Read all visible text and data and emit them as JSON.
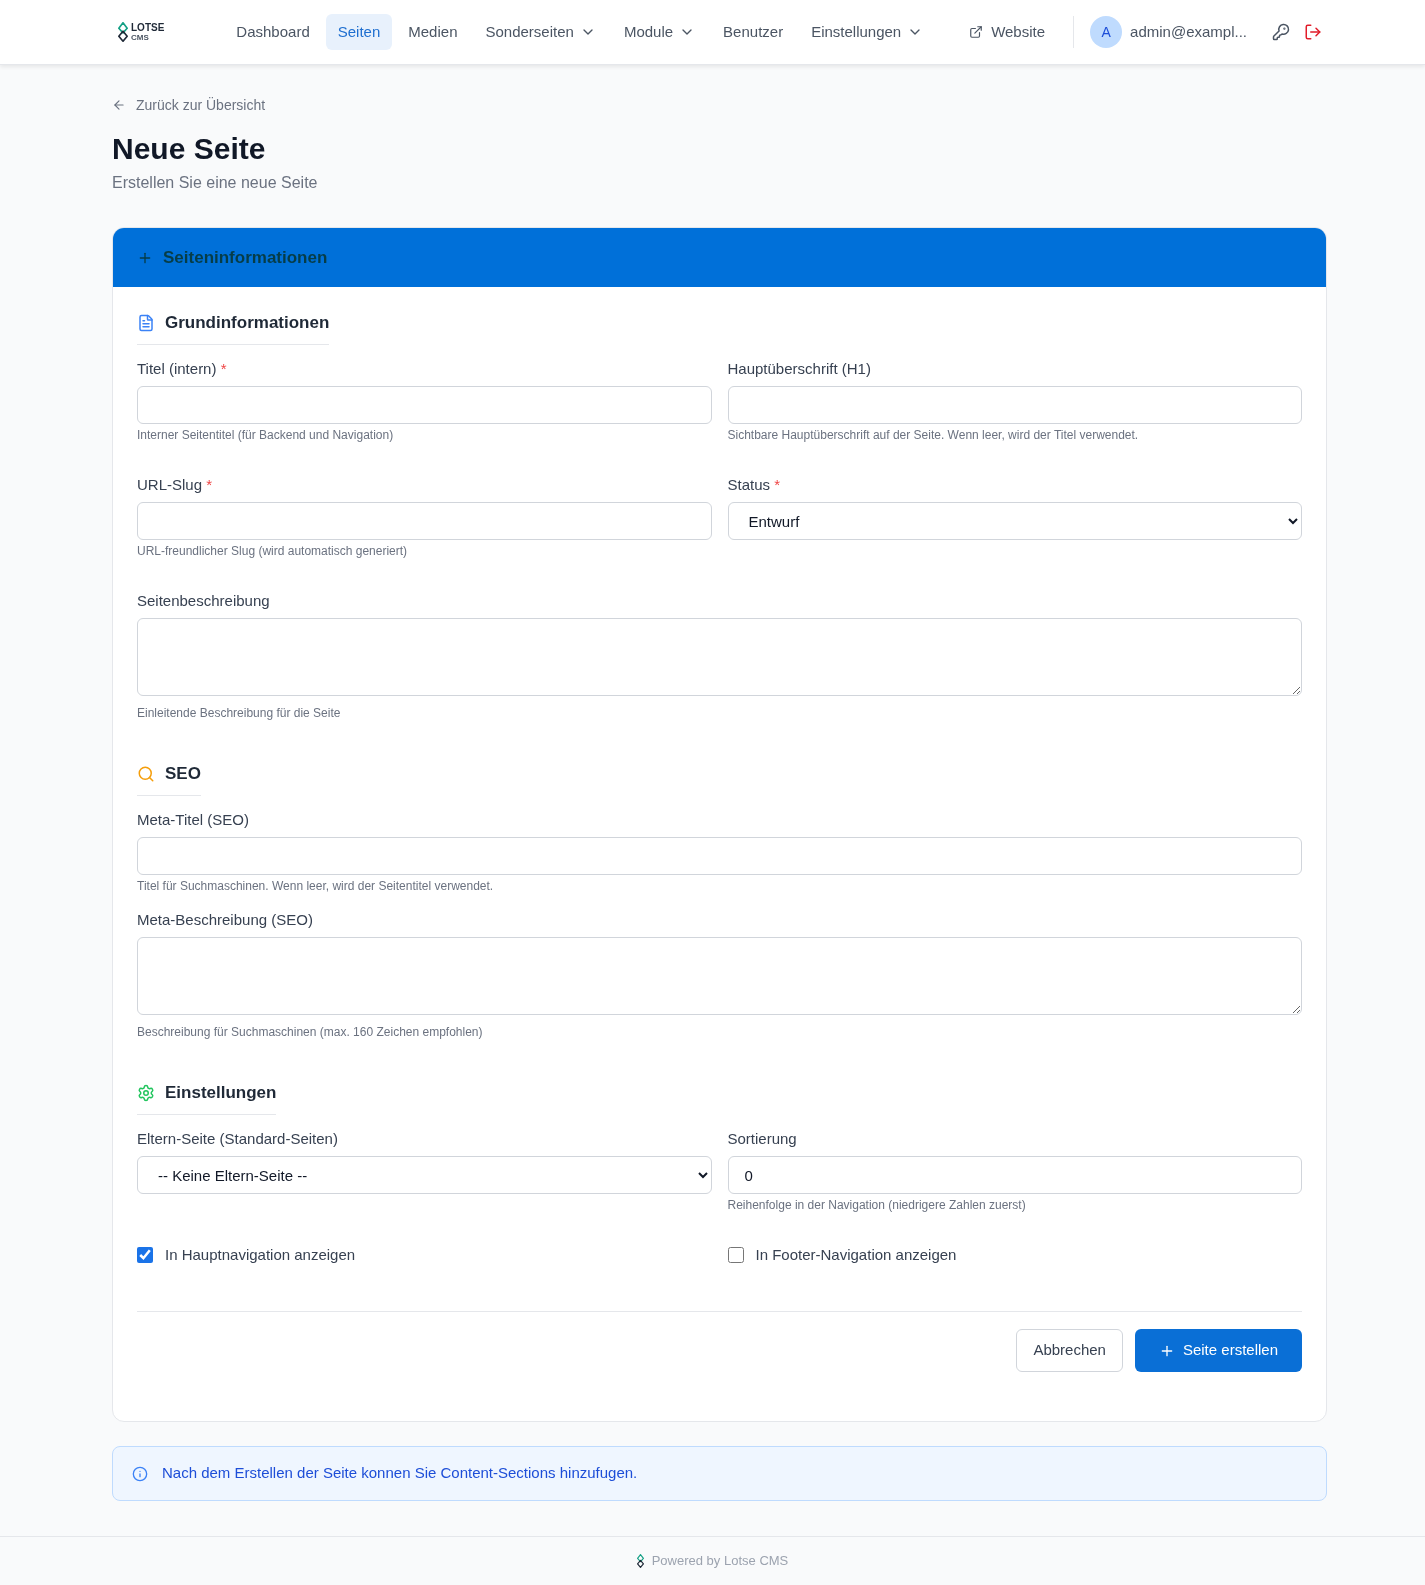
{
  "header": {
    "logo": {
      "name": "LOTSE",
      "tagline": "CMS"
    },
    "nav": [
      {
        "label": "Dashboard",
        "selected": false,
        "has_menu": false
      },
      {
        "label": "Seiten",
        "selected": true,
        "has_menu": false
      },
      {
        "label": "Medien",
        "selected": false,
        "has_menu": false
      },
      {
        "label": "Sonderseiten",
        "selected": false,
        "has_menu": true
      },
      {
        "label": "Module",
        "selected": false,
        "has_menu": true
      },
      {
        "label": "Benutzer",
        "selected": false,
        "has_menu": false
      },
      {
        "label": "Einstellungen",
        "selected": false,
        "has_menu": true
      }
    ],
    "website_link": "Website",
    "user": {
      "avatar": "A",
      "email": "admin@exampl..."
    }
  },
  "back_link": "Zurück zur Übersicht",
  "page": {
    "title": "Neue Seite",
    "subtitle": "Erstellen Sie eine neue Seite"
  },
  "card": {
    "title": "Seiteninformationen",
    "sections": [
      {
        "title": "Grundinformationen",
        "color": "#3b82f6",
        "rows": [
          [
            {
              "kind": "text",
              "label": "Titel (intern)",
              "required_mark": "*",
              "help": "Interner Seitentitel (für Backend und Navigation)"
            },
            {
              "kind": "text",
              "label": "Hauptüberschrift (H1)",
              "help": "Sichtbare Hauptüberschrift auf der Seite. Wenn leer, wird der Titel verwendet."
            }
          ],
          [
            {
              "kind": "text",
              "label": "URL-Slug",
              "required_mark": "*",
              "help": "URL-freundlicher Slug (wird automatisch generiert)"
            },
            {
              "kind": "select",
              "label": "Status",
              "required_mark": "*",
              "value": "Entwurf"
            }
          ],
          [
            {
              "kind": "textarea",
              "label": "Seitenbeschreibung",
              "help": "Einleitende Beschreibung für die Seite"
            }
          ]
        ]
      },
      {
        "title": "SEO",
        "color": "#f59e0b",
        "rows": [
          [
            {
              "kind": "text",
              "label": "Meta-Titel (SEO)",
              "help": "Titel für Suchmaschinen. Wenn leer, wird der Seitentitel verwendet."
            }
          ],
          [
            {
              "kind": "textarea",
              "label": "Meta-Beschreibung (SEO)",
              "help": "Beschreibung für Suchmaschinen (max. 160 Zeichen empfohlen)"
            }
          ]
        ]
      },
      {
        "title": "Einstellungen",
        "color": "#22c55e",
        "rows": [
          [
            {
              "kind": "select",
              "label": "Eltern-Seite (Standard-Seiten)",
              "value": "-- Keine Eltern-Seite --"
            },
            {
              "kind": "text",
              "label": "Sortierung",
              "value": "0",
              "help": "Reihenfolge in der Navigation (niedrigere Zahlen zuerst)"
            }
          ],
          [
            {
              "kind": "checkbox",
              "label": "In Hauptnavigation anzeigen",
              "checked": true
            },
            {
              "kind": "checkbox",
              "label": "In Footer-Navigation anzeigen",
              "checked": false
            }
          ]
        ]
      }
    ],
    "actions": [
      {
        "kind": "secondary",
        "label": "Abbrechen"
      },
      {
        "kind": "primary",
        "label": "Seite erstellen"
      }
    ]
  },
  "info": "Nach dem Erstellen der Seite konnen Sie Content-Sections hinzufugen.",
  "footer": "Powered by Lotse CMS"
}
